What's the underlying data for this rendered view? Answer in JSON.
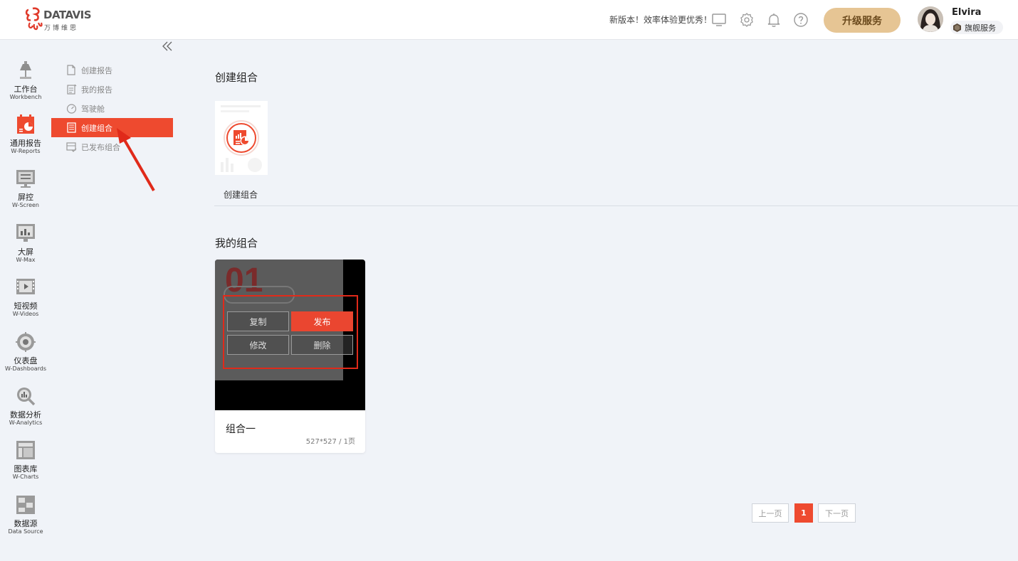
{
  "colors": {
    "accent": "#ee4a2f",
    "upgrade_bg": "#e6c594",
    "page_bg": "#f0f3f8",
    "annotation_red": "#e02a1a"
  },
  "header": {
    "logo_title": "DATAVIS",
    "logo_sub": "万博维思",
    "notice": "新版本！效率体验更优秀！",
    "icons": [
      "monitor-icon",
      "gear-icon",
      "bell-icon",
      "help-icon"
    ],
    "upgrade_label": "升级服务",
    "user_name": "Elvira",
    "plan_label": "旗舰服务"
  },
  "rail": [
    {
      "cn": "工作台",
      "en": "Workbench",
      "icon": "lamp-icon"
    },
    {
      "cn": "通用报告",
      "en": "W-Reports",
      "icon": "report-calendar-icon"
    },
    {
      "cn": "屏控",
      "en": "W-Screen",
      "icon": "screen-control-icon"
    },
    {
      "cn": "大屏",
      "en": "W-Max",
      "icon": "bigscreen-icon"
    },
    {
      "cn": "短视频",
      "en": "W-Videos",
      "icon": "video-icon"
    },
    {
      "cn": "仪表盘",
      "en": "W-Dashboards",
      "icon": "dashboard-icon"
    },
    {
      "cn": "数据分析",
      "en": "W-Analytics",
      "icon": "analytics-icon"
    },
    {
      "cn": "图表库",
      "en": "W-Charts",
      "icon": "charts-icon"
    },
    {
      "cn": "数据源",
      "en": "Data Source",
      "icon": "datasource-icon"
    }
  ],
  "submenu": [
    {
      "label": "创建报告",
      "icon": "new-doc-icon"
    },
    {
      "label": "我的报告",
      "icon": "my-report-icon"
    },
    {
      "label": "驾驶舱",
      "icon": "gauge-icon"
    },
    {
      "label": "创建组合",
      "icon": "combo-icon",
      "active": true
    },
    {
      "label": "已发布组合",
      "icon": "published-icon"
    }
  ],
  "main": {
    "create_section_title": "创建组合",
    "create_card_label": "创建组合",
    "my_section_title": "我的组合",
    "card": {
      "name": "组合一",
      "meta": "527*527 / 1页",
      "thumb_text": "01",
      "actions": {
        "copy": "复制",
        "publish": "发布",
        "edit": "修改",
        "delete": "删除"
      }
    }
  },
  "pagination": {
    "prev": "上一页",
    "current": "1",
    "next": "下一页"
  }
}
